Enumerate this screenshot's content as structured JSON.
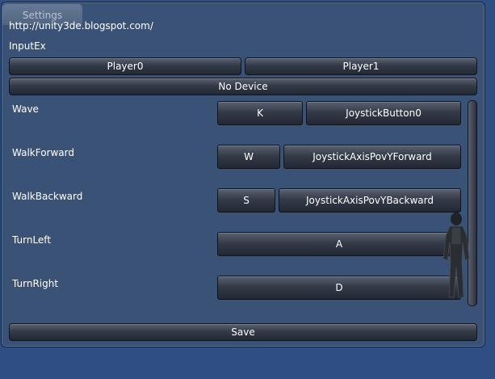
{
  "window": {
    "tab_label": "Settings"
  },
  "header": {
    "url": "http://unity3de.blogspot.com/",
    "section_title": "InputEx"
  },
  "players": [
    {
      "label": "Player0"
    },
    {
      "label": "Player1"
    }
  ],
  "device": {
    "label": "No Device"
  },
  "bindings": [
    {
      "action": "Wave",
      "key": "K",
      "joystick": "JoystickButton0"
    },
    {
      "action": "WalkForward",
      "key": "W",
      "joystick": "JoystickAxisPovYForward"
    },
    {
      "action": "WalkBackward",
      "key": "S",
      "joystick": "JoystickAxisPovYBackward"
    },
    {
      "action": "TurnLeft",
      "key": "A"
    },
    {
      "action": "TurnRight",
      "key": "D"
    }
  ],
  "footer": {
    "save_label": "Save"
  },
  "colors": {
    "background": "#2f4f82",
    "panel": "#3a5276",
    "button": "#2a303b"
  }
}
